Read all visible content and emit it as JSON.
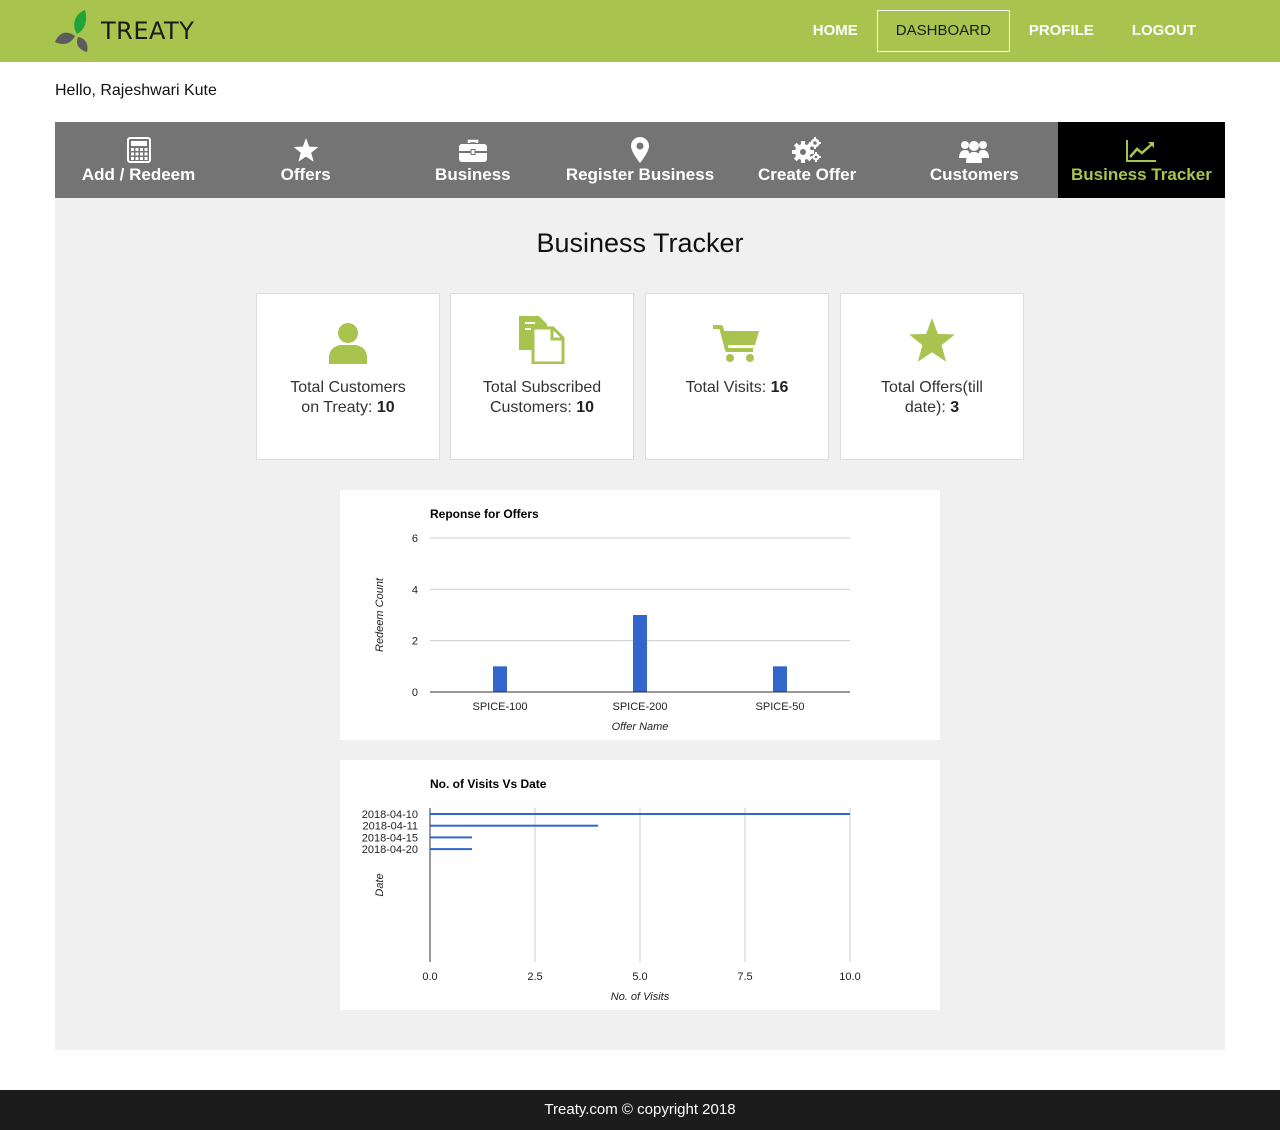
{
  "brand": {
    "name": "TREATY"
  },
  "topnav": [
    {
      "label": "HOME"
    },
    {
      "label": "DASHBOARD"
    },
    {
      "label": "PROFILE"
    },
    {
      "label": "LOGOUT"
    }
  ],
  "greeting": "Hello, Rajeshwari Kute",
  "tabs": [
    {
      "label": "Add / Redeem",
      "icon": "calculator-icon"
    },
    {
      "label": "Offers",
      "icon": "star-icon"
    },
    {
      "label": "Business",
      "icon": "briefcase-icon"
    },
    {
      "label": "Register Business",
      "icon": "map-marker-icon"
    },
    {
      "label": "Create Offer",
      "icon": "gears-icon"
    },
    {
      "label": "Customers",
      "icon": "users-icon"
    },
    {
      "label": "Business Tracker",
      "icon": "line-chart-icon"
    }
  ],
  "page_title": "Business Tracker",
  "stats": [
    {
      "label": "Total Customers on Treaty: ",
      "value": "10",
      "icon": "user-icon"
    },
    {
      "label": "Total Subscribed Customers: ",
      "value": "10",
      "icon": "documents-icon"
    },
    {
      "label": "Total Visits: ",
      "value": "16",
      "icon": "cart-icon"
    },
    {
      "label": "Total Offers(till date): ",
      "value": "3",
      "icon": "star-icon"
    }
  ],
  "colors": {
    "brand": "#a8c44f",
    "bar": "#3366cc",
    "tabs_bg": "#747474",
    "footer_bg": "#1c1c1c"
  },
  "chart_data": [
    {
      "type": "bar",
      "title": "Reponse for Offers",
      "xlabel": "Offer Name",
      "ylabel": "Redeem Count",
      "categories": [
        "SPICE-100",
        "SPICE-200",
        "SPICE-50"
      ],
      "values": [
        1,
        3,
        1
      ],
      "ylim": [
        0,
        6
      ],
      "yticks": [
        "0",
        "2",
        "4",
        "6"
      ],
      "grid": true
    },
    {
      "type": "bar",
      "orientation": "horizontal",
      "title": "No. of Visits Vs Date",
      "xlabel": "No. of Visits",
      "ylabel": "Date",
      "categories": [
        "2018-04-10",
        "2018-04-11",
        "2018-04-15",
        "2018-04-20"
      ],
      "values": [
        10,
        4,
        1,
        1
      ],
      "xlim": [
        0,
        10
      ],
      "xticks": [
        "0.0",
        "2.5",
        "5.0",
        "7.5",
        "10.0"
      ],
      "grid": true
    }
  ],
  "footer": "Treaty.com © copyright 2018"
}
